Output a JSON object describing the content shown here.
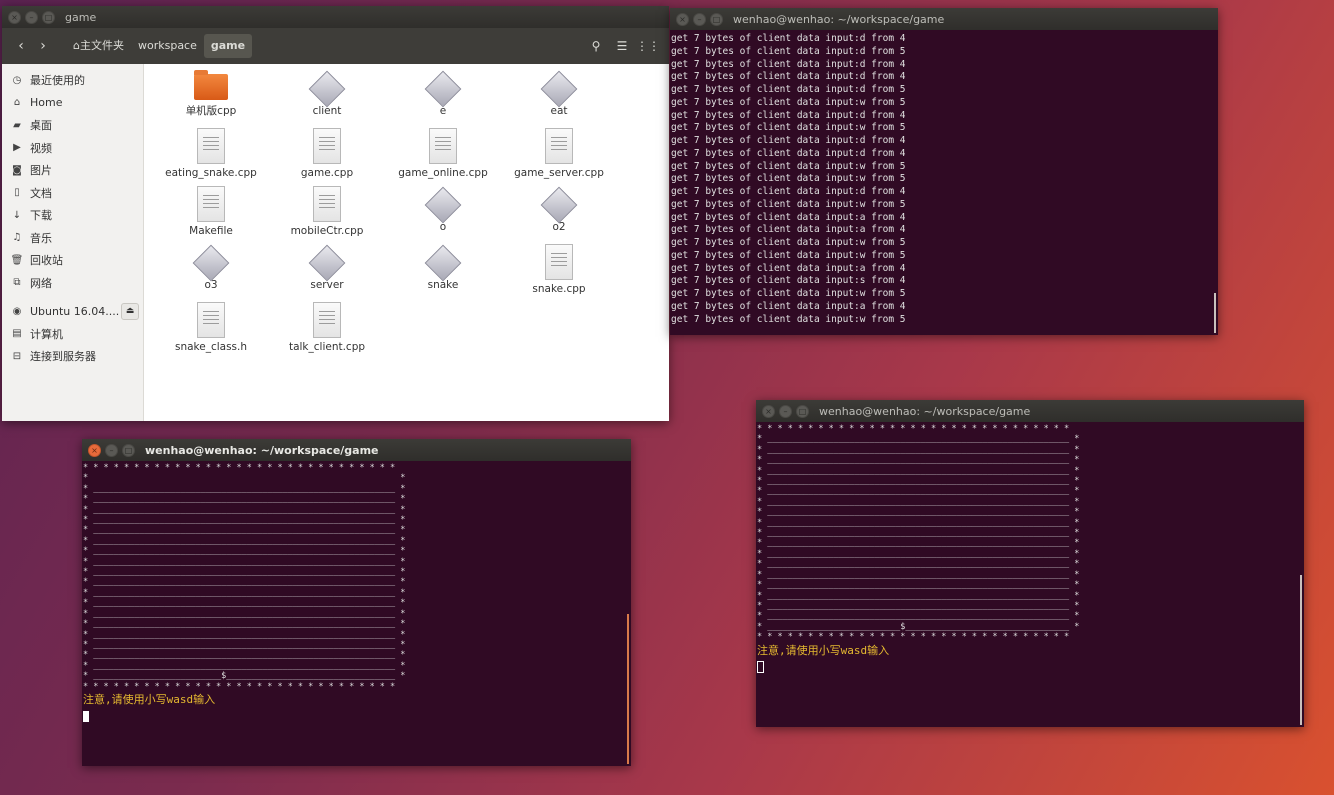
{
  "file_manager": {
    "title": "game",
    "breadcrumbs": [
      "主文件夹",
      "workspace",
      "game"
    ],
    "sidebar": [
      "最近使用的",
      "Home",
      "桌面",
      "视频",
      "图片",
      "文档",
      "下载",
      "音乐",
      "回收站",
      "网络"
    ],
    "devices": [
      "Ubuntu 16.04....",
      "计算机",
      "连接到服务器"
    ],
    "files": [
      {
        "name": "单机版cpp",
        "type": "folder"
      },
      {
        "name": "client",
        "type": "exec"
      },
      {
        "name": "e",
        "type": "exec"
      },
      {
        "name": "eat",
        "type": "exec"
      },
      {
        "name": "eating_snake.cpp",
        "type": "doc"
      },
      {
        "name": "game.cpp",
        "type": "doc"
      },
      {
        "name": "game_online.cpp",
        "type": "doc"
      },
      {
        "name": "game_server.cpp",
        "type": "doc"
      },
      {
        "name": "Makefile",
        "type": "doc"
      },
      {
        "name": "mobileCtr.cpp",
        "type": "doc"
      },
      {
        "name": "o",
        "type": "exec"
      },
      {
        "name": "o2",
        "type": "exec"
      },
      {
        "name": "o3",
        "type": "exec"
      },
      {
        "name": "server",
        "type": "exec"
      },
      {
        "name": "snake",
        "type": "exec"
      },
      {
        "name": "snake.cpp",
        "type": "doc"
      },
      {
        "name": "snake_class.h",
        "type": "doc"
      },
      {
        "name": "talk_client.cpp",
        "type": "doc"
      }
    ]
  },
  "server_terminal": {
    "title": "wenhao@wenhao: ~/workspace/game",
    "lines": [
      "get 7 bytes of client data input:d from 4",
      "get 7 bytes of client data input:d from 5",
      "get 7 bytes of client data input:d from 4",
      "get 7 bytes of client data input:d from 4",
      "get 7 bytes of client data input:d from 5",
      "get 7 bytes of client data input:w from 5",
      "get 7 bytes of client data input:d from 4",
      "get 7 bytes of client data input:w from 5",
      "get 7 bytes of client data input:d from 4",
      "get 7 bytes of client data input:d from 4",
      "get 7 bytes of client data input:w from 5",
      "get 7 bytes of client data input:w from 5",
      "get 7 bytes of client data input:d from 4",
      "get 7 bytes of client data input:w from 5",
      "get 7 bytes of client data input:a from 4",
      "get 7 bytes of client data input:a from 4",
      "get 7 bytes of client data input:w from 5",
      "get 7 bytes of client data input:w from 5",
      "get 7 bytes of client data input:a from 4",
      "get 7 bytes of client data input:s from 4",
      "get 7 bytes of client data input:w from 5",
      "get 7 bytes of client data input:a from 4",
      "get 7 bytes of client data input:w from 5"
    ]
  },
  "client_terminal_left": {
    "title": "wenhao@wenhao: ~/workspace/game",
    "board": [
      "* * * * * * * * * * * * * * * * * * * * * * * * * * * * * * * * * * * * * * * * * * * *",
      "*                                                                                       *",
      "* ________________________________________________________________________________________ *",
      "* ________________________________________________________________________________________ *",
      "* ______________________________________________________________________________o_______ *",
      "* ____________________________________________________________________________@o______ *",
      "* ________________________________________________________________________________________ *",
      "* ________________________________________________________________________________________ *",
      "* _________________________________________________________________@______________________ *",
      "* _________________________________________________________________o______________________ *",
      "* _________________________________________________________________o______________________ *",
      "* _________________________________________________________________o______________________ *",
      "* _________________________________________________________________o______________________ *",
      "* _________________________________________________________________o______________________ *",
      "* ________________________________________________________________________________________ *",
      "* ________________________________________________________________________________________ *",
      "* ________________________________________________________________________________________ *",
      "* ________________________________________________________________________________________ *",
      "* ________________________________________________________________________________________ *",
      "* ________________________________________________________________________________________ *",
      "* _________________________$______________________________________________________________ *",
      "* * * * * * * * * * * * * * * * * * * * * * * * * * * * * * * * * * * * * * * * * * * *"
    ],
    "notice": "注意,请使用小写wasd输入"
  },
  "client_terminal_right": {
    "title": "wenhao@wenhao: ~/workspace/game",
    "board": [
      "* * * * * * * * * * * * * * * * * * * * * * * * * * * * * * * * * * * * * * * * * * * *",
      "* ________________________________________________________________________________________ *",
      "* ________________________________________________________________________________________ *",
      "* ________________________________________________________________________________________ *",
      "* ____________________________________________________________________________________o___ *",
      "* __________________________________________________________________________________@o___ *",
      "* ________________________________________________________________________________________ *",
      "* ________________________________________________________________________________________ *",
      "* ________________________________________________________________@_______________________ *",
      "* ________________________________________________________________o_______________________ *",
      "* ________________________________________________________________o_______________________ *",
      "* ________________________________________________________________o_______________________ *",
      "* ________________________________________________________________o_______________________ *",
      "* ________________________________________________________________o_______________________ *",
      "* ________________________________________________________________________________________ *",
      "* ________________________________________________________________________________________ *",
      "* ________________________________________________________________________________________ *",
      "* ________________________________________________________________________________________ *",
      "* ________________________________________________________________________________________ *",
      "* __________________________$_____________________________________________________________ *",
      "* * * * * * * * * * * * * * * * * * * * * * * * * * * * * * * * * * * * * * * * * * * *"
    ],
    "notice": "注意,请使用小写wasd输入"
  }
}
